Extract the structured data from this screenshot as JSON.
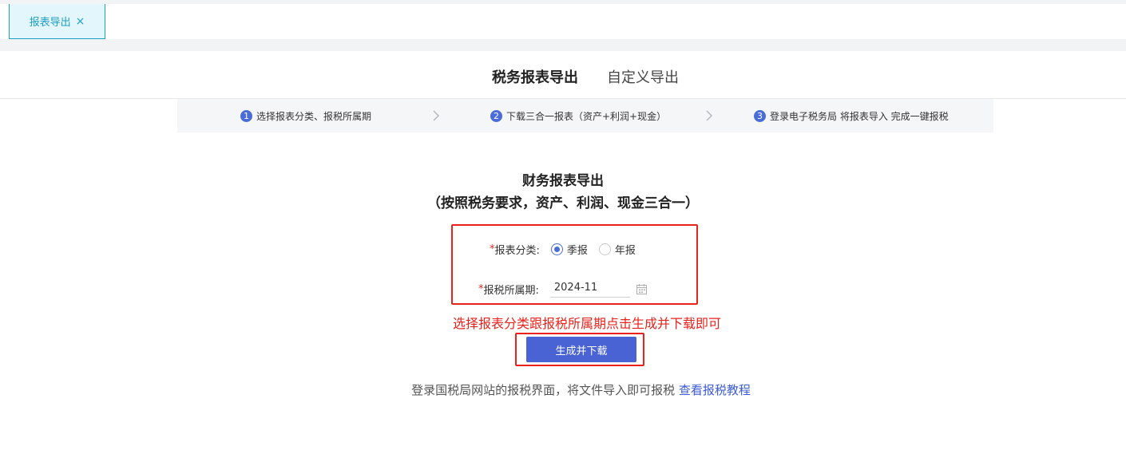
{
  "tab": {
    "label": "报表导出",
    "close": "×"
  },
  "subtabs": {
    "active": "税务报表导出",
    "inactive": "自定义导出"
  },
  "steps": [
    {
      "num": "1",
      "text": "选择报表分类、报税所属期"
    },
    {
      "num": "2",
      "text": "下载三合一报表（资产+利润+现金）"
    },
    {
      "num": "3",
      "text": "登录电子税务局 将报表导入 完成一键报税"
    }
  ],
  "heading": {
    "title": "财务报表导出",
    "subtitle": "（按照税务要求，资产、利润、现金三合一）"
  },
  "form": {
    "required_mark": "*",
    "category_label": "报表分类:",
    "options": [
      {
        "label": "季报",
        "selected": true
      },
      {
        "label": "年报",
        "selected": false
      }
    ],
    "period_label": "报税所属期:",
    "period_value": "2024-11"
  },
  "hint": "选择报表分类跟报税所属期点击生成并下载即可",
  "button": {
    "label": "生成并下载"
  },
  "footer": {
    "text": "登录国税局网站的报税界面，将文件导入即可报税",
    "link": "查看报税教程"
  },
  "colors": {
    "accent": "#4a63d4",
    "highlight": "#e8231c",
    "tab": "#1ea0c4"
  }
}
